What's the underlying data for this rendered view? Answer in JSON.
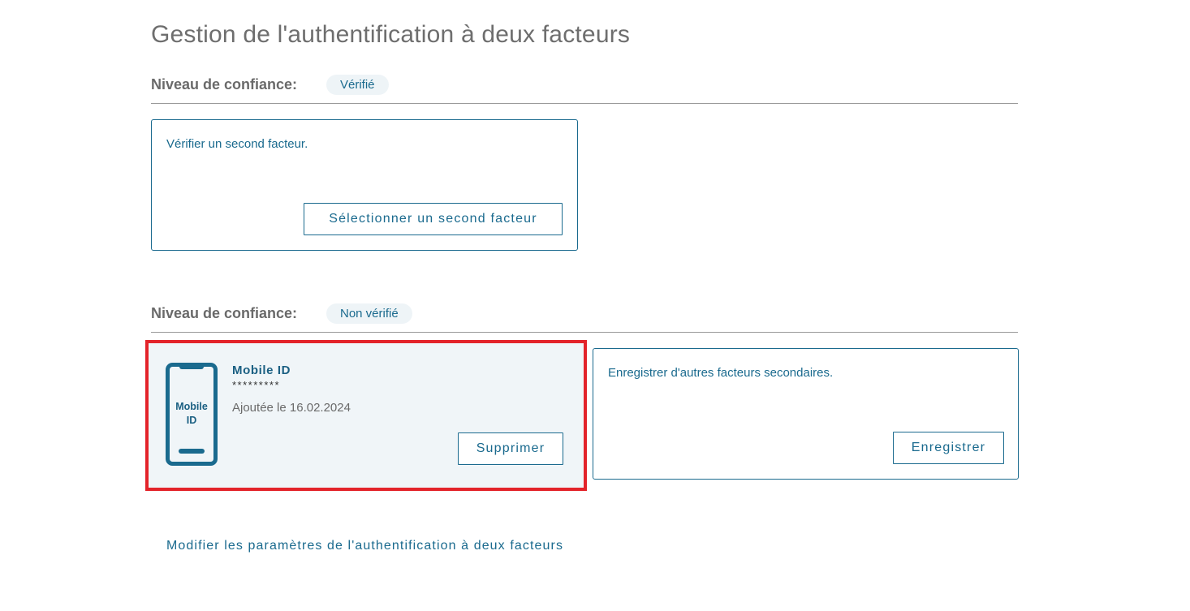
{
  "page": {
    "title": "Gestion de l'authentification à deux facteurs"
  },
  "sections": [
    {
      "trust_label": "Niveau de confiance:",
      "trust_badge": "Vérifié",
      "card": {
        "message": "Vérifier un second facteur.",
        "button_label": "Sélectionner un second facteur"
      }
    },
    {
      "trust_label": "Niveau de confiance:",
      "trust_badge": "Non vérifié",
      "factor": {
        "icon_text_line1": "Mobile",
        "icon_text_line2": "ID",
        "name": "Mobile ID",
        "masked_value": "*********",
        "added_date": "Ajoutée le 16.02.2024",
        "delete_label": "Supprimer"
      },
      "card": {
        "message": "Enregistrer d'autres facteurs secondaires.",
        "button_label": "Enregistrer"
      }
    }
  ],
  "footer": {
    "settings_link": "Modifier les paramètres de l'authentification à deux facteurs"
  },
  "colors": {
    "accent": "#1a6a8e",
    "highlight": "#e3232a",
    "badge_bg": "#eef4f7",
    "factor_bg": "#f0f5f8"
  },
  "icons": {
    "factor_icon": "mobile-phone-icon"
  }
}
